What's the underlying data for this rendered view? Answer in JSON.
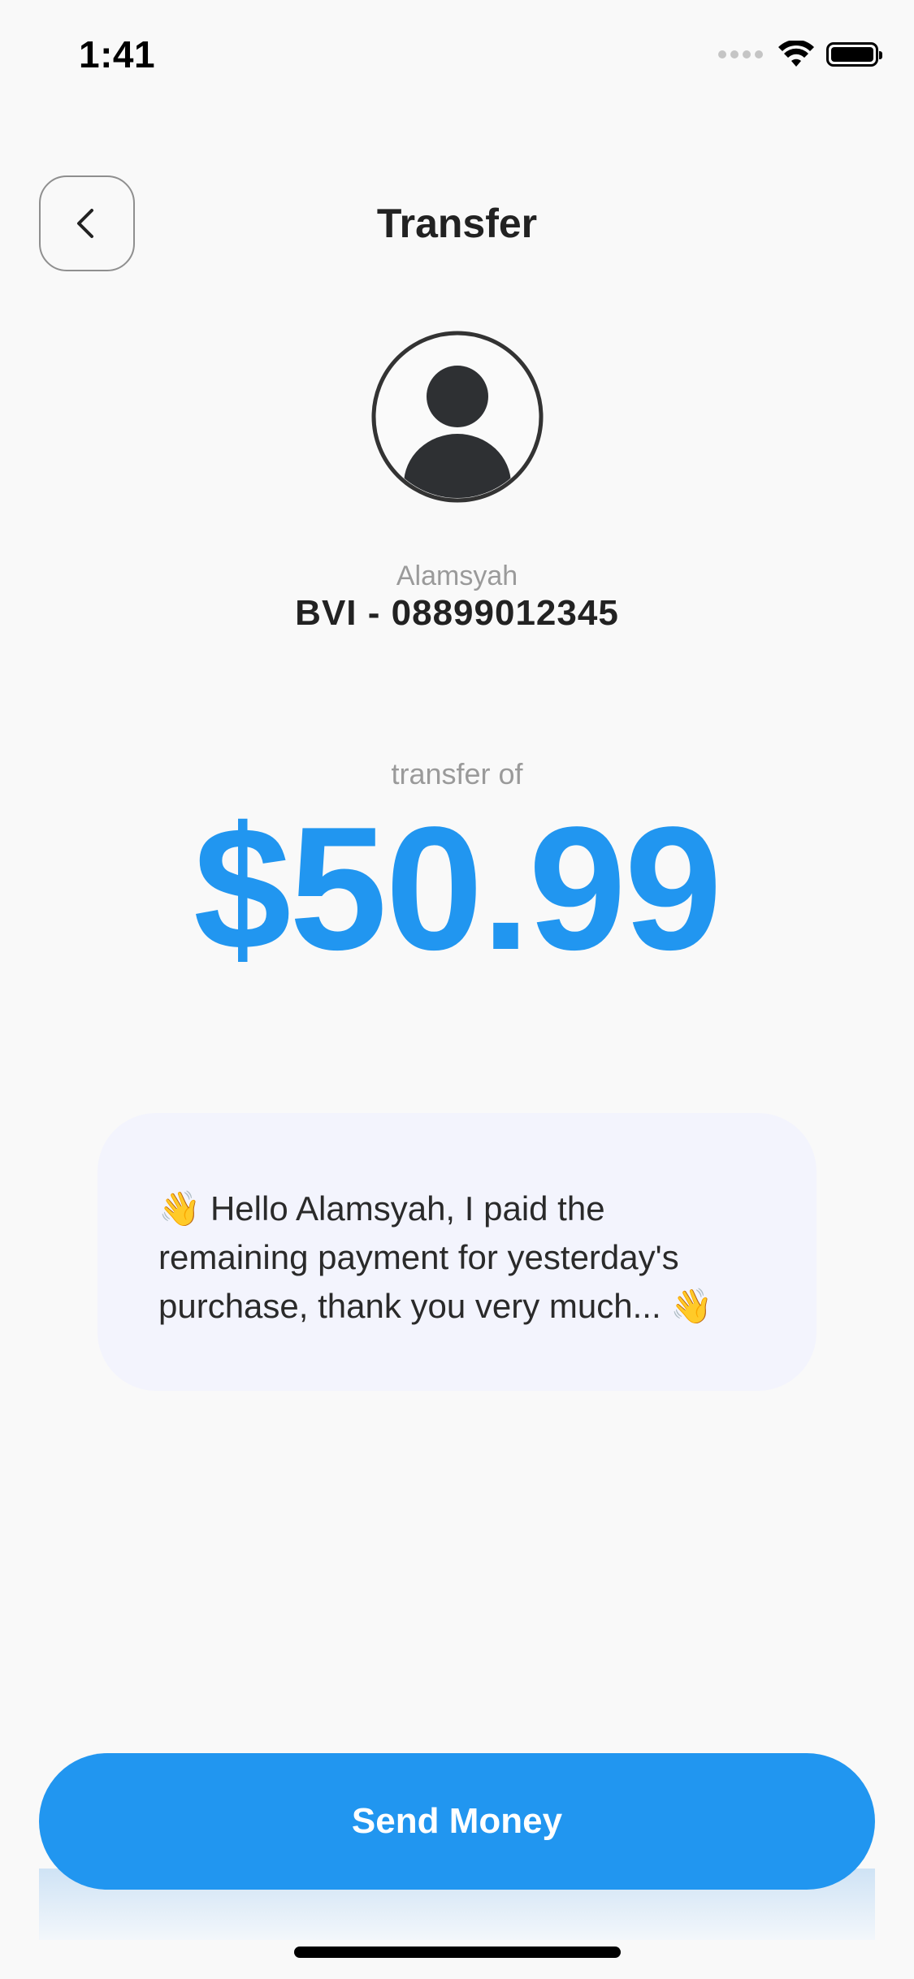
{
  "status_bar": {
    "time": "1:41",
    "icons": [
      "signal-icon",
      "wifi-icon",
      "battery-icon"
    ]
  },
  "header": {
    "title": "Transfer",
    "back_icon": "chevron-left-icon"
  },
  "recipient": {
    "avatar_icon": "user-avatar-icon",
    "name": "Alamsyah",
    "account": "BVI - 08899012345"
  },
  "transfer": {
    "label": "transfer of",
    "amount": "$50.99"
  },
  "message": {
    "text": "👋 Hello Alamsyah, I paid the remaining payment for yesterday's purchase, thank you very much... 👋"
  },
  "actions": {
    "send_label": "Send Money"
  },
  "colors": {
    "accent": "#2196f0",
    "message_background": "#f3f4fd",
    "page_background": "#f9f9f9",
    "muted_text": "#9a9a9a",
    "primary_text": "#222222"
  }
}
